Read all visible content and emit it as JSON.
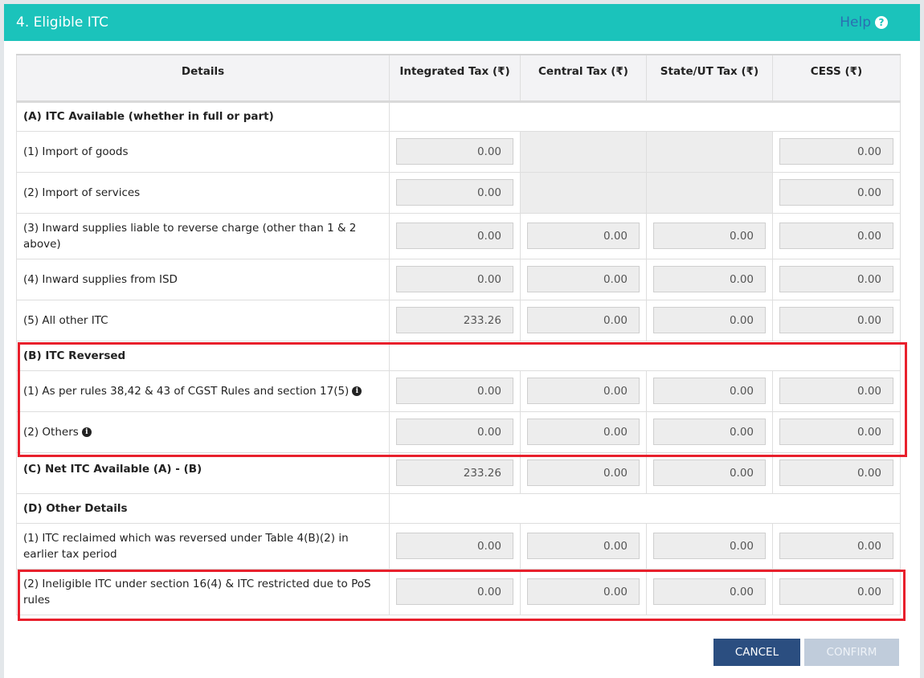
{
  "header": {
    "title": "4. Eligible ITC",
    "help_label": "Help",
    "help_icon": "question-circle-icon"
  },
  "table": {
    "columns": [
      "Details",
      "Integrated Tax (₹)",
      "Central Tax (₹)",
      "State/UT Tax (₹)",
      "CESS (₹)"
    ],
    "rows": [
      {
        "type": "section",
        "label": "(A) ITC Available (whether in full or part)"
      },
      {
        "type": "data",
        "label": "(1) Import of goods",
        "values": [
          "0.00",
          null,
          null,
          "0.00"
        ]
      },
      {
        "type": "data",
        "label": "(2) Import of services",
        "values": [
          "0.00",
          null,
          null,
          "0.00"
        ]
      },
      {
        "type": "data",
        "label": "(3) Inward supplies liable to reverse charge (other than 1 & 2 above)",
        "values": [
          "0.00",
          "0.00",
          "0.00",
          "0.00"
        ]
      },
      {
        "type": "data",
        "label": "(4) Inward supplies from ISD",
        "values": [
          "0.00",
          "0.00",
          "0.00",
          "0.00"
        ]
      },
      {
        "type": "data",
        "label": "(5) All other ITC",
        "values": [
          "233.26",
          "0.00",
          "0.00",
          "0.00"
        ]
      },
      {
        "type": "section",
        "label": "(B) ITC Reversed"
      },
      {
        "type": "data",
        "label": "(1) As per rules 38,42 & 43 of CGST Rules and section 17(5)",
        "info": true,
        "values": [
          "0.00",
          "0.00",
          "0.00",
          "0.00"
        ]
      },
      {
        "type": "data",
        "label": "(2) Others",
        "info": true,
        "values": [
          "0.00",
          "0.00",
          "0.00",
          "0.00"
        ]
      },
      {
        "type": "total",
        "label": "(C) Net ITC Available (A) - (B)",
        "values": [
          "233.26",
          "0.00",
          "0.00",
          "0.00"
        ]
      },
      {
        "type": "section",
        "label": "(D) Other Details"
      },
      {
        "type": "data",
        "label": "(1) ITC reclaimed which was reversed under Table 4(B)(2) in earlier tax period",
        "values": [
          "0.00",
          "0.00",
          "0.00",
          "0.00"
        ]
      },
      {
        "type": "data",
        "label": "(2) Ineligible ITC under section 16(4) & ITC restricted due to PoS rules",
        "values": [
          "0.00",
          "0.00",
          "0.00",
          "0.00"
        ]
      }
    ]
  },
  "buttons": {
    "cancel": "CANCEL",
    "confirm": "CONFIRM"
  },
  "colors": {
    "header_bg": "#1bc3bb",
    "highlight": "#e8202c",
    "cancel_bg": "#2b4e80",
    "confirm_disabled_bg": "#c0ccdb"
  }
}
